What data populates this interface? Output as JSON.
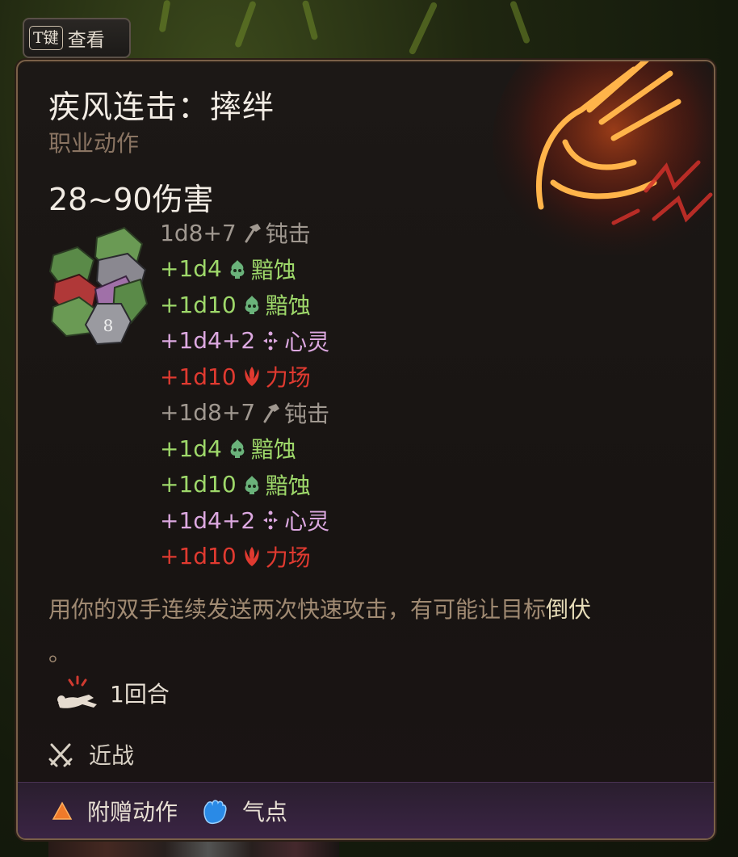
{
  "key_hint": {
    "key": "T键",
    "label": "查看"
  },
  "tooltip": {
    "title": "疾风连击：摔绊",
    "subtitle": "职业动作",
    "damage_total": "28~90伤害",
    "damage_lines": [
      {
        "dice": "1d8+7",
        "type": "钝击",
        "color": "grey",
        "icon": "bludgeoning-hammer-icon"
      },
      {
        "dice": "+1d4",
        "type": "黯蚀",
        "color": "green",
        "icon": "necrotic-skull-icon"
      },
      {
        "dice": "+1d10",
        "type": "黯蚀",
        "color": "green",
        "icon": "necrotic-skull-icon"
      },
      {
        "dice": "+1d4+2",
        "type": "心灵",
        "color": "pink",
        "icon": "psychic-icon"
      },
      {
        "dice": "+1d10",
        "type": "力场",
        "color": "red",
        "icon": "force-icon"
      },
      {
        "dice": "+1d8+7",
        "type": "钝击",
        "color": "grey",
        "icon": "bludgeoning-hammer-icon"
      },
      {
        "dice": "+1d4",
        "type": "黯蚀",
        "color": "green",
        "icon": "necrotic-skull-icon"
      },
      {
        "dice": "+1d10",
        "type": "黯蚀",
        "color": "green",
        "icon": "necrotic-skull-icon"
      },
      {
        "dice": "+1d4+2",
        "type": "心灵",
        "color": "pink",
        "icon": "psychic-icon"
      },
      {
        "dice": "+1d10",
        "type": "力场",
        "color": "red",
        "icon": "force-icon"
      }
    ],
    "description": "用你的双手连续发送两次快速攻击，有可能让目标",
    "description_highlight": "倒伏",
    "description_end": "。",
    "duration": "1回合",
    "range": "近战",
    "footer": {
      "action_label": "附赠动作",
      "resource_label": "气点"
    }
  },
  "colors": {
    "grey": "#a09890",
    "green": "#9ed86a",
    "pink": "#dca8e0",
    "red": "#e03a30",
    "title": "#f2ece4",
    "subtitle": "#8a7462",
    "description": "#a08a72",
    "highlight": "#e6dcb8"
  }
}
